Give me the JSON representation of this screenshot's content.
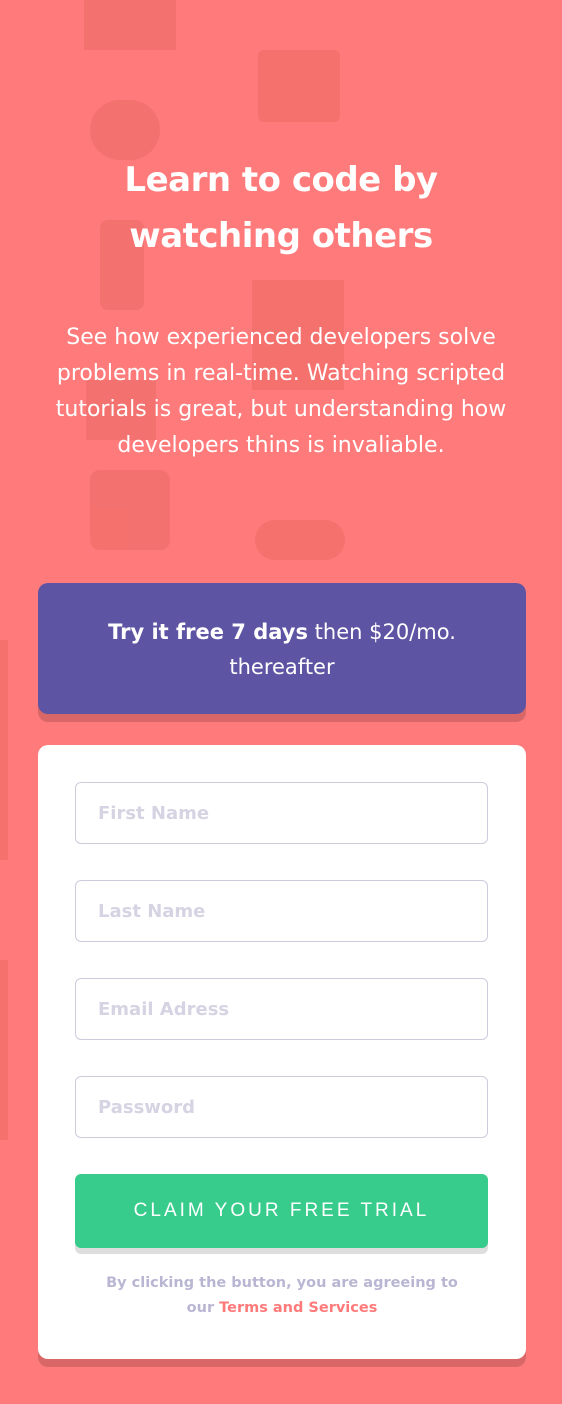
{
  "hero": {
    "title": "Learn to code by watching others",
    "description": "See how experienced developers solve problems in real-time. Watching scripted tutorials is great, but understanding how developers thins is invaliable."
  },
  "promo": {
    "bold": "Try it free 7 days",
    "rest": " then $20/mo. thereafter"
  },
  "form": {
    "first_name_placeholder": "First Name",
    "last_name_placeholder": "Last Name",
    "email_placeholder": "Email Adress",
    "password_placeholder": "Password",
    "submit_label": "CLAIM YOUR FREE TRIAL",
    "terms_prefix": "By clicking the button, you are agreeing to our ",
    "terms_link": "Terms and Services"
  },
  "colors": {
    "background": "#ff7a7a",
    "promo": "#5e54a4",
    "cta": "#38cc8c",
    "link": "#ff7a7a"
  }
}
